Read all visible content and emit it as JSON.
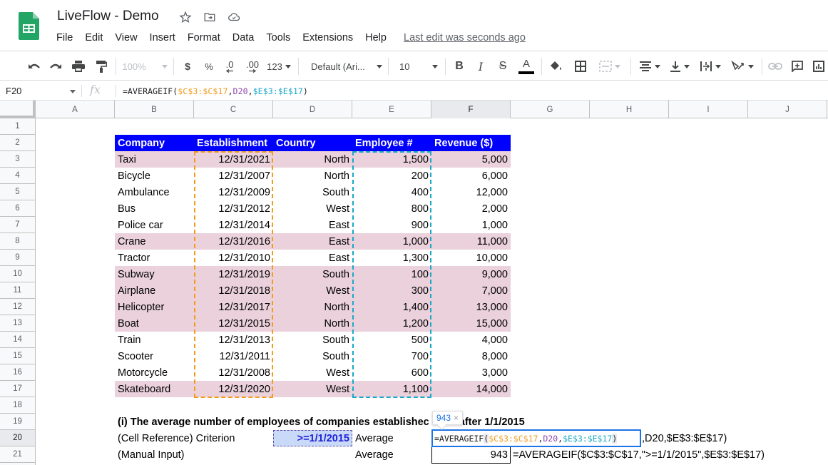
{
  "app": {
    "title": "LiveFlow - Demo",
    "menu": [
      "File",
      "Edit",
      "View",
      "Insert",
      "Format",
      "Data",
      "Tools",
      "Extensions",
      "Help"
    ],
    "last_edit": "Last edit was seconds ago"
  },
  "toolbar": {
    "zoom": "100%",
    "currency": "$",
    "percent": "%",
    "decrease_decimal": ".0",
    "increase_decimal": ".00",
    "more_formats": "123",
    "font": "Default (Ari...",
    "font_size": "10",
    "bold": "B",
    "italic": "I",
    "strikethrough": "S",
    "text_color": "A",
    "text_color_value": "#000000"
  },
  "formula_bar": {
    "name_box": "F20",
    "fx": "fx",
    "formula_parts": [
      {
        "text": "=AVERAGEIF(",
        "color": "default"
      },
      {
        "text": "$C$3:$C$17",
        "color": "orange"
      },
      {
        "text": ",",
        "color": "default"
      },
      {
        "text": "D20",
        "color": "purple"
      },
      {
        "text": ",",
        "color": "default"
      },
      {
        "text": "$E$3:$E$17",
        "color": "blue"
      },
      {
        "text": ")",
        "color": "default"
      }
    ]
  },
  "grid": {
    "columns": [
      "A",
      "B",
      "C",
      "D",
      "E",
      "F",
      "G",
      "H",
      "I",
      "J"
    ],
    "selected_column": "F",
    "rows": [
      "1",
      "2",
      "3",
      "4",
      "5",
      "6",
      "7",
      "8",
      "9",
      "10",
      "11",
      "12",
      "13",
      "14",
      "15",
      "16",
      "17",
      "18",
      "19",
      "20",
      "21"
    ],
    "selected_row": "20"
  },
  "table": {
    "headers": [
      "Company",
      "Establishment",
      "Country",
      "Employee #",
      "Revenue ($)"
    ],
    "header_color": "#0000ff",
    "highlight_color": "#ead1dc",
    "rows": [
      {
        "company": "Taxi",
        "established": "12/31/2021",
        "country": "North",
        "employees": "1,500",
        "revenue": "5,000",
        "highlight": true
      },
      {
        "company": "Bicycle",
        "established": "12/31/2007",
        "country": "North",
        "employees": "200",
        "revenue": "6,000",
        "highlight": false
      },
      {
        "company": "Ambulance",
        "established": "12/31/2009",
        "country": "South",
        "employees": "400",
        "revenue": "12,000",
        "highlight": false
      },
      {
        "company": "Bus",
        "established": "12/31/2012",
        "country": "West",
        "employees": "800",
        "revenue": "2,000",
        "highlight": false
      },
      {
        "company": "Police car",
        "established": "12/31/2014",
        "country": "East",
        "employees": "900",
        "revenue": "1,000",
        "highlight": false
      },
      {
        "company": "Crane",
        "established": "12/31/2016",
        "country": "East",
        "employees": "1,000",
        "revenue": "11,000",
        "highlight": true
      },
      {
        "company": "Tractor",
        "established": "12/31/2010",
        "country": "East",
        "employees": "1,300",
        "revenue": "10,000",
        "highlight": false
      },
      {
        "company": "Subway",
        "established": "12/31/2019",
        "country": "South",
        "employees": "100",
        "revenue": "9,000",
        "highlight": true
      },
      {
        "company": "Airplane",
        "established": "12/31/2018",
        "country": "West",
        "employees": "300",
        "revenue": "7,000",
        "highlight": true
      },
      {
        "company": "Helicopter",
        "established": "12/31/2017",
        "country": "North",
        "employees": "1,400",
        "revenue": "13,000",
        "highlight": true
      },
      {
        "company": "Boat",
        "established": "12/31/2015",
        "country": "North",
        "employees": "1,200",
        "revenue": "15,000",
        "highlight": true
      },
      {
        "company": "Train",
        "established": "12/31/2013",
        "country": "South",
        "employees": "500",
        "revenue": "4,000",
        "highlight": false
      },
      {
        "company": "Scooter",
        "established": "12/31/2011",
        "country": "South",
        "employees": "700",
        "revenue": "8,000",
        "highlight": false
      },
      {
        "company": "Motorcycle",
        "established": "12/31/2008",
        "country": "West",
        "employees": "600",
        "revenue": "3,000",
        "highlight": false
      },
      {
        "company": "Skateboard",
        "established": "12/31/2020",
        "country": "West",
        "employees": "1,100",
        "revenue": "14,000",
        "highlight": true
      }
    ]
  },
  "question": {
    "title_left": "(i) The average number of employees of companies establishec",
    "title_right": "after 1/1/2015",
    "row20_label": "(Cell Reference) Criterion",
    "criterion_value": ">=1/1/2015",
    "average_label": "Average",
    "row20_suffix": ",D20,$E$3:$E$17)",
    "row21_label": "(Manual Input)",
    "row21_value": "943",
    "row21_formula": "=AVERAGEIF($C$3:$C$17,\">=1/1/2015\",$E$3:$E$17)",
    "tooltip_value": "943",
    "tooltip_close": "×",
    "editing_formula": {
      "prefix": "=AVERAGEIF",
      "open": "(",
      "arg1": "$C$3:$C$17",
      "comma1": ",",
      "arg2": "D20",
      "comma2": ",",
      "arg3": "$E$3:$E$17",
      "close": ")"
    }
  }
}
